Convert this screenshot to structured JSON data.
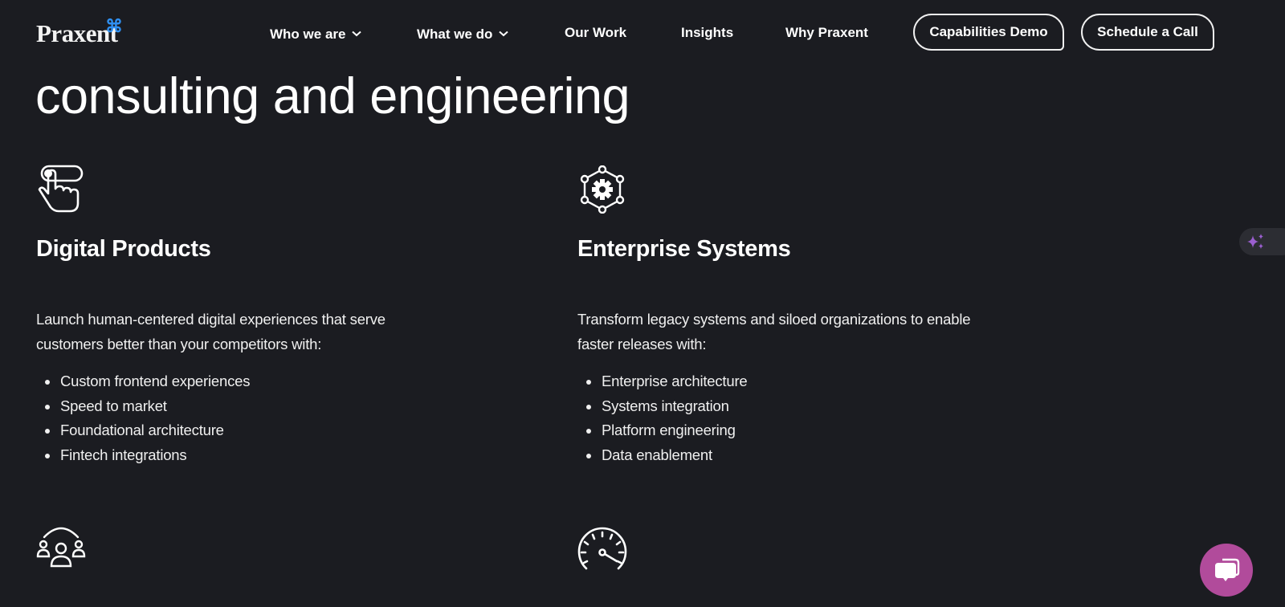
{
  "header": {
    "logo": "Praxent",
    "logo_mark": "⌘",
    "nav": [
      {
        "label": "Who we are",
        "has_dropdown": true
      },
      {
        "label": "What we do",
        "has_dropdown": true
      },
      {
        "label": "Our Work",
        "has_dropdown": false
      },
      {
        "label": "Insights",
        "has_dropdown": false
      },
      {
        "label": "Why Praxent",
        "has_dropdown": false
      }
    ],
    "buttons": {
      "capabilities_demo": "Capabilities Demo",
      "schedule_call": "Schedule a Call"
    }
  },
  "hero": {
    "headline": "consulting and engineering"
  },
  "cards": [
    {
      "icon": "hand-pointer-toggle-icon",
      "title": "Digital Products",
      "description": "Launch human-centered digital experiences that serve customers better than your competitors with:",
      "items": [
        "Custom frontend experiences",
        "Speed to market",
        "Foundational architecture",
        "Fintech integrations"
      ]
    },
    {
      "icon": "gear-network-icon",
      "title": "Enterprise Systems",
      "description": "Transform legacy systems and siloed organizations to enable faster releases with:",
      "items": [
        "Enterprise architecture",
        "Systems integration",
        "Platform engineering",
        "Data enablement"
      ]
    },
    {
      "icon": "team-arc-icon"
    },
    {
      "icon": "speedometer-icon"
    }
  ],
  "widgets": {
    "ai_assistant_icon": "sparkles-icon",
    "chat_icon": "chat-bubbles-icon"
  },
  "colors": {
    "background": "#1b1c21",
    "text": "#ffffff",
    "logo_mark": "#2f8ff0",
    "chat_fab": "#b14b9b",
    "sparkle": "#9b5fd0"
  }
}
